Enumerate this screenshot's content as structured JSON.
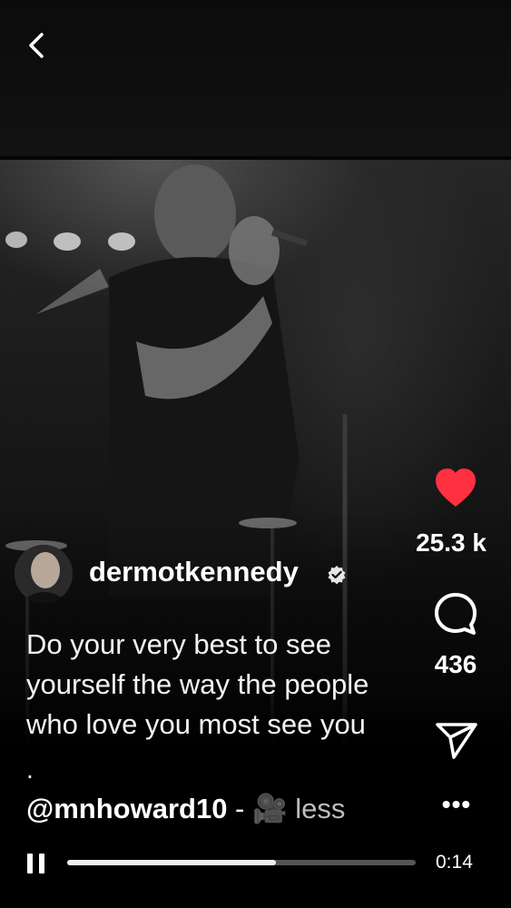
{
  "header": {
    "back_icon": "chevron-left-icon"
  },
  "post": {
    "username": "dermotkennedy",
    "verified": true,
    "caption": "Do your very best to see yourself the way the people who love you most see you",
    "caption_dot": ".",
    "mention": "@mnhoward10",
    "mention_suffix": " - 🎥 ",
    "less_label": "less"
  },
  "actions": {
    "like_count": "25.3 k",
    "like_color": "#ff3040",
    "comment_count": "436",
    "more_label": "•••"
  },
  "player": {
    "elapsed": "0:14",
    "progress": 0.6
  }
}
